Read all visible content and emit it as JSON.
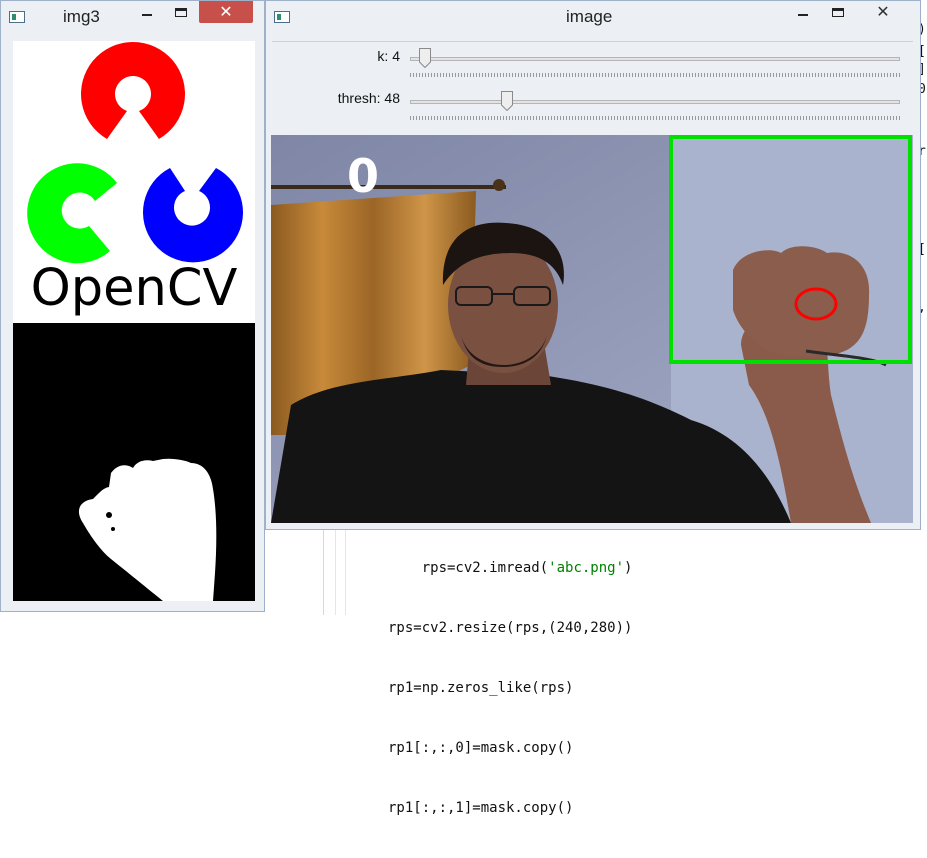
{
  "editor": {
    "code_lines": [
      {
        "prefix": "    rps=cv2.imread(",
        "string": "'abc.png'",
        "suffix": ")"
      },
      {
        "prefix": "rps=cv2.resize(rps,(240,280))",
        "string": "",
        "suffix": ""
      },
      {
        "prefix": "rp1=np.zeros_like(rps)",
        "string": "",
        "suffix": ""
      },
      {
        "prefix": "rp1[:,:,0]=mask.copy()",
        "string": "",
        "suffix": ""
      },
      {
        "prefix": "rp1[:,:,1]=mask.copy()",
        "string": "",
        "suffix": ""
      }
    ],
    "right_fragments": [
      ")",
      "[",
      "]",
      "0",
      "r",
      "[",
      ","
    ]
  },
  "img3_window": {
    "title": "img3",
    "close_symbol": "✕",
    "logo_text": "OpenCV",
    "logo_colors": {
      "red": "#ff0000",
      "green": "#00ff00",
      "blue": "#0000ff",
      "text": "#000000"
    }
  },
  "image_window": {
    "title": "image",
    "close_symbol": "✕",
    "trackbars": [
      {
        "label": "k: 4",
        "value": 4,
        "max": 255
      },
      {
        "label": "thresh: 48",
        "value": 48,
        "max": 255
      }
    ],
    "overlay_count": "0",
    "roi_box_color": "#00e000",
    "marker_color": "#ff0000"
  }
}
